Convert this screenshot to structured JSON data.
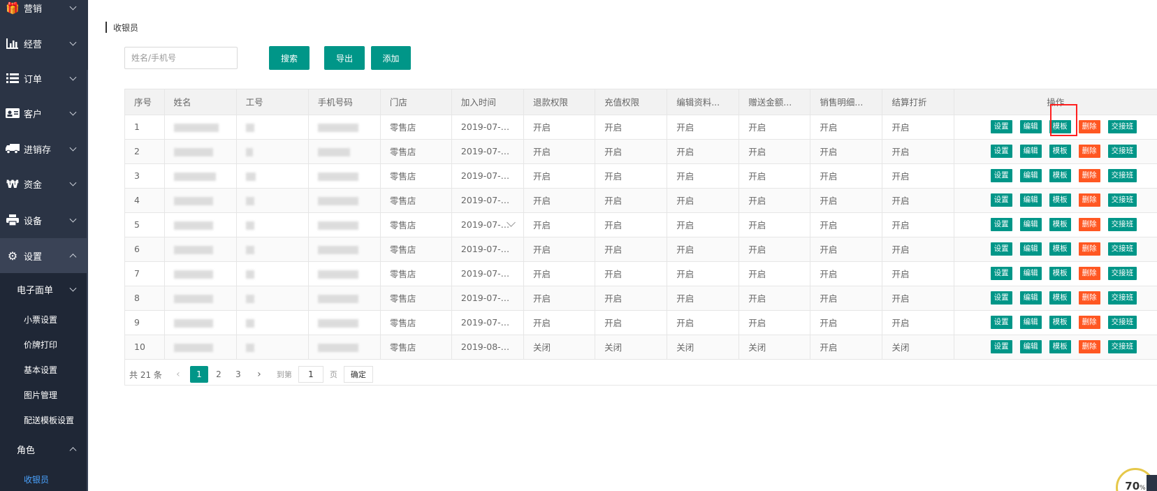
{
  "sidebar": {
    "items": [
      {
        "label": "营销",
        "icon": "gift-icon"
      },
      {
        "label": "经营",
        "icon": "bar-chart-icon"
      },
      {
        "label": "订单",
        "icon": "list-icon"
      },
      {
        "label": "客户",
        "icon": "id-card-icon"
      },
      {
        "label": "进销存",
        "icon": "truck-icon"
      },
      {
        "label": "资金",
        "icon": "won-icon"
      },
      {
        "label": "设备",
        "icon": "printer-icon"
      },
      {
        "label": "设置",
        "icon": "gear-icon"
      }
    ],
    "settings_children": {
      "electronic_form": "电子面单",
      "links": [
        "小票设置",
        "价牌打印",
        "基本设置",
        "图片管理",
        "配送模板设置"
      ],
      "role": "角色",
      "current": "收银员"
    }
  },
  "page": {
    "title": "收银员"
  },
  "toolbar": {
    "search_placeholder": "姓名/手机号",
    "search_label": "搜索",
    "export_label": "导出",
    "add_label": "添加"
  },
  "table": {
    "headers": [
      "序号",
      "姓名",
      "工号",
      "手机号码",
      "门店",
      "加入时间",
      "退款权限",
      "充值权限",
      "编辑资料...",
      "赠送金额...",
      "销售明细...",
      "结算打折",
      "操作"
    ],
    "rows": [
      {
        "idx": "1",
        "store": "零售店",
        "joined": "2019-07-3...",
        "refund": "开启",
        "recharge": "开启",
        "edit": "开启",
        "gift": "开启",
        "sales": "开启",
        "discount": "开启"
      },
      {
        "idx": "2",
        "store": "零售店",
        "joined": "2019-07-3...",
        "refund": "开启",
        "recharge": "开启",
        "edit": "开启",
        "gift": "开启",
        "sales": "开启",
        "discount": "开启"
      },
      {
        "idx": "3",
        "store": "零售店",
        "joined": "2019-07-3...",
        "refund": "开启",
        "recharge": "开启",
        "edit": "开启",
        "gift": "开启",
        "sales": "开启",
        "discount": "开启"
      },
      {
        "idx": "4",
        "store": "零售店",
        "joined": "2019-07-3...",
        "refund": "开启",
        "recharge": "开启",
        "edit": "开启",
        "gift": "开启",
        "sales": "开启",
        "discount": "开启"
      },
      {
        "idx": "5",
        "store": "零售店",
        "joined": "2019-07-3...",
        "refund": "开启",
        "recharge": "开启",
        "edit": "开启",
        "gift": "开启",
        "sales": "开启",
        "discount": "开启"
      },
      {
        "idx": "6",
        "store": "零售店",
        "joined": "2019-07-3...",
        "refund": "开启",
        "recharge": "开启",
        "edit": "开启",
        "gift": "开启",
        "sales": "开启",
        "discount": "开启"
      },
      {
        "idx": "7",
        "store": "零售店",
        "joined": "2019-07-3...",
        "refund": "开启",
        "recharge": "开启",
        "edit": "开启",
        "gift": "开启",
        "sales": "开启",
        "discount": "开启"
      },
      {
        "idx": "8",
        "store": "零售店",
        "joined": "2019-07-3...",
        "refund": "开启",
        "recharge": "开启",
        "edit": "开启",
        "gift": "开启",
        "sales": "开启",
        "discount": "开启"
      },
      {
        "idx": "9",
        "store": "零售店",
        "joined": "2019-07-3...",
        "refund": "开启",
        "recharge": "开启",
        "edit": "开启",
        "gift": "开启",
        "sales": "开启",
        "discount": "开启"
      },
      {
        "idx": "10",
        "store": "零售店",
        "joined": "2019-08-0...",
        "refund": "关闭",
        "recharge": "关闭",
        "edit": "关闭",
        "gift": "关闭",
        "sales": "开启",
        "discount": "关闭"
      }
    ],
    "actions": {
      "settings": "设置",
      "edit": "编辑",
      "template": "模板",
      "delete": "删除",
      "handover": "交接班"
    }
  },
  "pagination": {
    "total": "共 21 条",
    "pages": [
      "1",
      "2",
      "3"
    ],
    "current": "1",
    "goto_label": "到第",
    "goto_value": "1",
    "page_unit": "页",
    "confirm_label": "确定"
  },
  "indicator": {
    "value": "70",
    "unit": "%"
  },
  "colors": {
    "sidebar_bg": "#2b3445",
    "primary": "#009688",
    "danger": "#ff5722",
    "active_link": "#4aa3ff",
    "highlight": "#ff2020"
  }
}
